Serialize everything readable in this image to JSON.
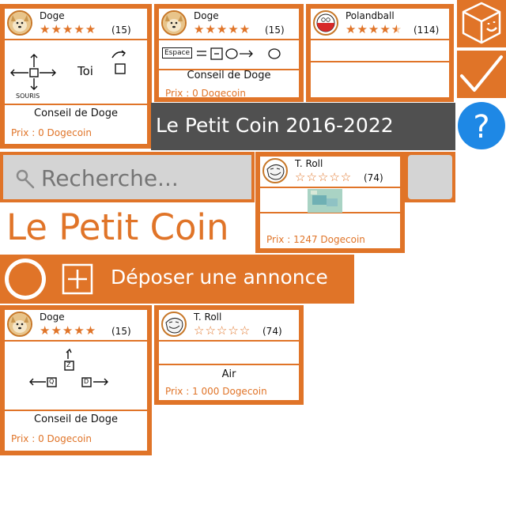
{
  "header": {
    "banner_title": "Le Petit Coin 2016-2022",
    "logo_text": "Le Petit Coin",
    "post_label": "Déposer une annonce"
  },
  "search": {
    "placeholder": "Recherche..."
  },
  "currency": "Dogecoin",
  "listings": [
    {
      "seller": "Doge",
      "rating": 5,
      "rating_count": "(15)",
      "sketch_labels": [
        "SOURIS",
        "Toi"
      ],
      "title": "Conseil de Doge",
      "price": "Prix : 0 Dogecoin"
    },
    {
      "seller": "Doge",
      "rating": 5,
      "rating_count": "(15)",
      "sketch_labels": [
        "Espace"
      ],
      "title": "Conseil de Doge",
      "price": "Prix : 0 Dogecoin"
    },
    {
      "seller": "Polandball",
      "rating": 4.5,
      "rating_count": "(114)",
      "title": "",
      "price": ""
    },
    {
      "seller": "T. Roll",
      "rating": 0,
      "rating_count": "(74)",
      "title": "",
      "price": "Prix : 1247 Dogecoin"
    },
    {
      "seller": "Doge",
      "rating": 5,
      "rating_count": "(15)",
      "sketch_labels": [
        "Z",
        "Q",
        "D"
      ],
      "title": "Conseil de Doge",
      "price": "Prix : 0 Dogecoin"
    },
    {
      "seller": "T. Roll",
      "rating": 0,
      "rating_count": "(74)",
      "title": "Air",
      "price": "Prix : 1 000 Dogecoin"
    }
  ],
  "icons": [
    "box-face-icon",
    "checkmark-icon",
    "help-icon",
    "search-icon",
    "radio-icon",
    "plus-icon"
  ],
  "colors": {
    "accent": "#e07428",
    "banner": "#505050",
    "help": "#1e88e5",
    "search_bg": "#d4d4d4"
  }
}
